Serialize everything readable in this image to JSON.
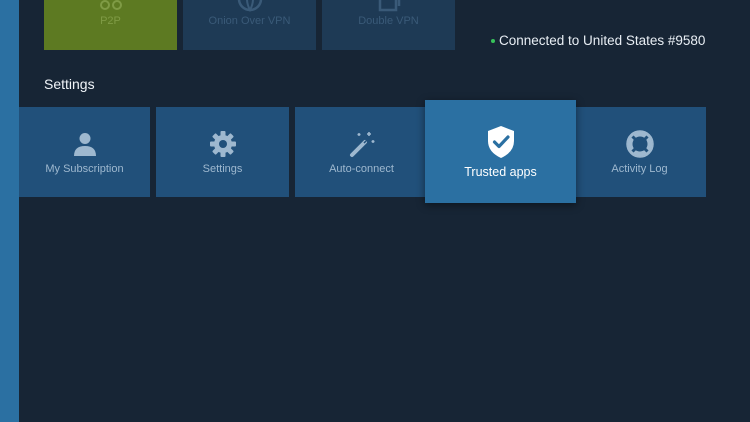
{
  "top_tiles": [
    {
      "label": "P2P"
    },
    {
      "label": "Onion Over VPN"
    },
    {
      "label": "Double VPN"
    }
  ],
  "status": {
    "text": "Connected to United States #9580",
    "dot_color": "#37c25a"
  },
  "section": {
    "title": "Settings"
  },
  "tiles": [
    {
      "label": "My Subscription",
      "icon": "user-icon"
    },
    {
      "label": "Settings",
      "icon": "gear-icon"
    },
    {
      "label": "Auto-connect",
      "icon": "magic-wand-icon"
    },
    {
      "label": "Trusted apps",
      "icon": "shield-check-icon",
      "selected": true
    },
    {
      "label": "Activity Log",
      "icon": "lifebuoy-icon"
    }
  ],
  "colors": {
    "background": "#172535",
    "tile": "#21507a",
    "tile_selected": "#2b70a2",
    "p2p_tile": "#5d7a22",
    "left_strip": "#2b70a2"
  }
}
